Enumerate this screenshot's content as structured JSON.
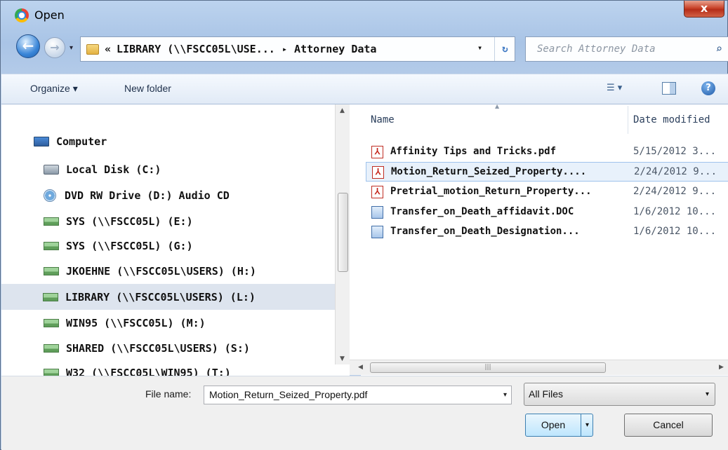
{
  "window": {
    "title": "Open",
    "close_glyph": "x"
  },
  "nav_buttons": {
    "back_glyph": "←",
    "forward_glyph": "→",
    "history_glyph": "▾"
  },
  "address": {
    "prefix": "«",
    "path": "LIBRARY (\\\\FSCC05L\\USE...",
    "separator": "▸",
    "current": "Attorney Data",
    "dropdown_glyph": "▾",
    "refresh_glyph": "↻"
  },
  "search": {
    "placeholder": "Search Attorney Data",
    "icon_glyph": "⌕"
  },
  "toolbar": {
    "organize_label": "Organize ▾",
    "new_folder_label": "New folder",
    "views_glyph": "☰ ▾",
    "help_glyph": "?"
  },
  "navigation": {
    "items": [
      {
        "label": "Computer",
        "icon": "computer-icon"
      },
      {
        "label": "Local Disk (C:)",
        "icon": "disk-icon"
      },
      {
        "label": "DVD RW Drive (D:) Audio CD",
        "icon": "dvd-icon"
      },
      {
        "label": "SYS (\\\\FSCC05L) (E:)",
        "icon": "network-drive-icon"
      },
      {
        "label": "SYS (\\\\FSCC05L) (G:)",
        "icon": "network-drive-icon"
      },
      {
        "label": "JKOEHNE (\\\\FSCC05L\\USERS) (H:)",
        "icon": "network-drive-icon"
      },
      {
        "label": "LIBRARY (\\\\FSCC05L\\USERS) (L:)",
        "icon": "network-drive-icon",
        "selected": true
      },
      {
        "label": "WIN95 (\\\\FSCC05L) (M:)",
        "icon": "network-drive-icon"
      },
      {
        "label": "SHARED (\\\\FSCC05L\\USERS) (S:)",
        "icon": "network-drive-icon"
      },
      {
        "label": "W32 (\\\\FSCC05L\\WIN95) (T:)",
        "icon": "network-drive-icon"
      }
    ]
  },
  "files": {
    "columns": {
      "name": "Name",
      "date": "Date modified"
    },
    "rows": [
      {
        "name": "Affinity Tips and Tricks.pdf",
        "date": "5/15/2012 3...",
        "type": "pdf"
      },
      {
        "name": "Motion_Return_Seized_Property....",
        "date": "2/24/2012 9...",
        "type": "pdf",
        "selected": true
      },
      {
        "name": "Pretrial_motion_Return_Property...",
        "date": "2/24/2012 9...",
        "type": "pdf"
      },
      {
        "name": "Transfer_on_Death_affidavit.DOC",
        "date": "1/6/2012 10...",
        "type": "doc"
      },
      {
        "name": "Transfer_on_Death_Designation...",
        "date": "1/6/2012 10...",
        "type": "doc"
      }
    ]
  },
  "footer": {
    "file_name_label": "File name:",
    "file_name_value": "Motion_Return_Seized_Property.pdf",
    "filter_value": "All Files",
    "open_label": "Open",
    "cancel_label": "Cancel",
    "dropdown_glyph": "▾"
  }
}
